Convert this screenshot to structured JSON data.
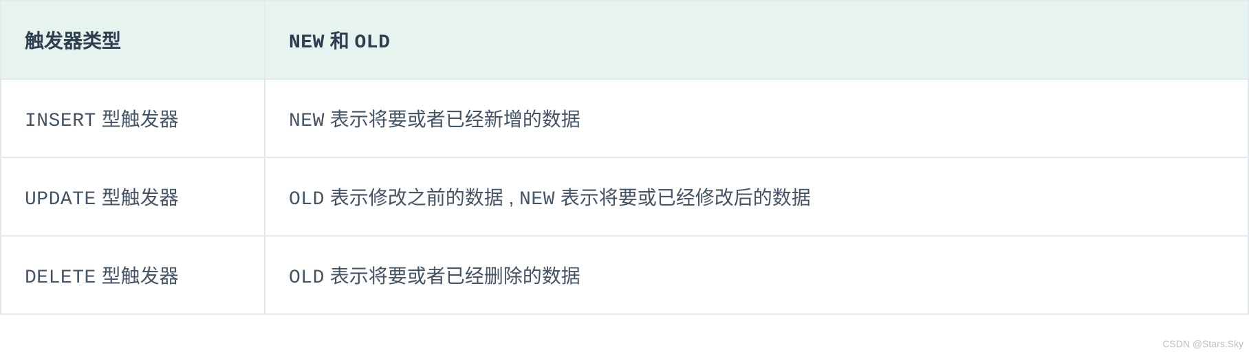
{
  "table": {
    "headers": {
      "col1": "触发器类型",
      "col2_code1": "NEW",
      "col2_mid": " 和 ",
      "col2_code2": "OLD"
    },
    "rows": [
      {
        "type_code": "INSERT",
        "type_suffix": " 型触发器",
        "desc_parts": [
          {
            "code": "NEW"
          },
          {
            "text": " 表示将要或者已经新增的数据"
          }
        ]
      },
      {
        "type_code": "UPDATE",
        "type_suffix": " 型触发器",
        "desc_parts": [
          {
            "code": "OLD"
          },
          {
            "text": " 表示修改之前的数据 , "
          },
          {
            "code": "NEW"
          },
          {
            "text": " 表示将要或已经修改后的数据"
          }
        ]
      },
      {
        "type_code": "DELETE",
        "type_suffix": " 型触发器",
        "desc_parts": [
          {
            "code": "OLD"
          },
          {
            "text": " 表示将要或者已经删除的数据"
          }
        ]
      }
    ]
  },
  "watermark": "CSDN @Stars.Sky"
}
